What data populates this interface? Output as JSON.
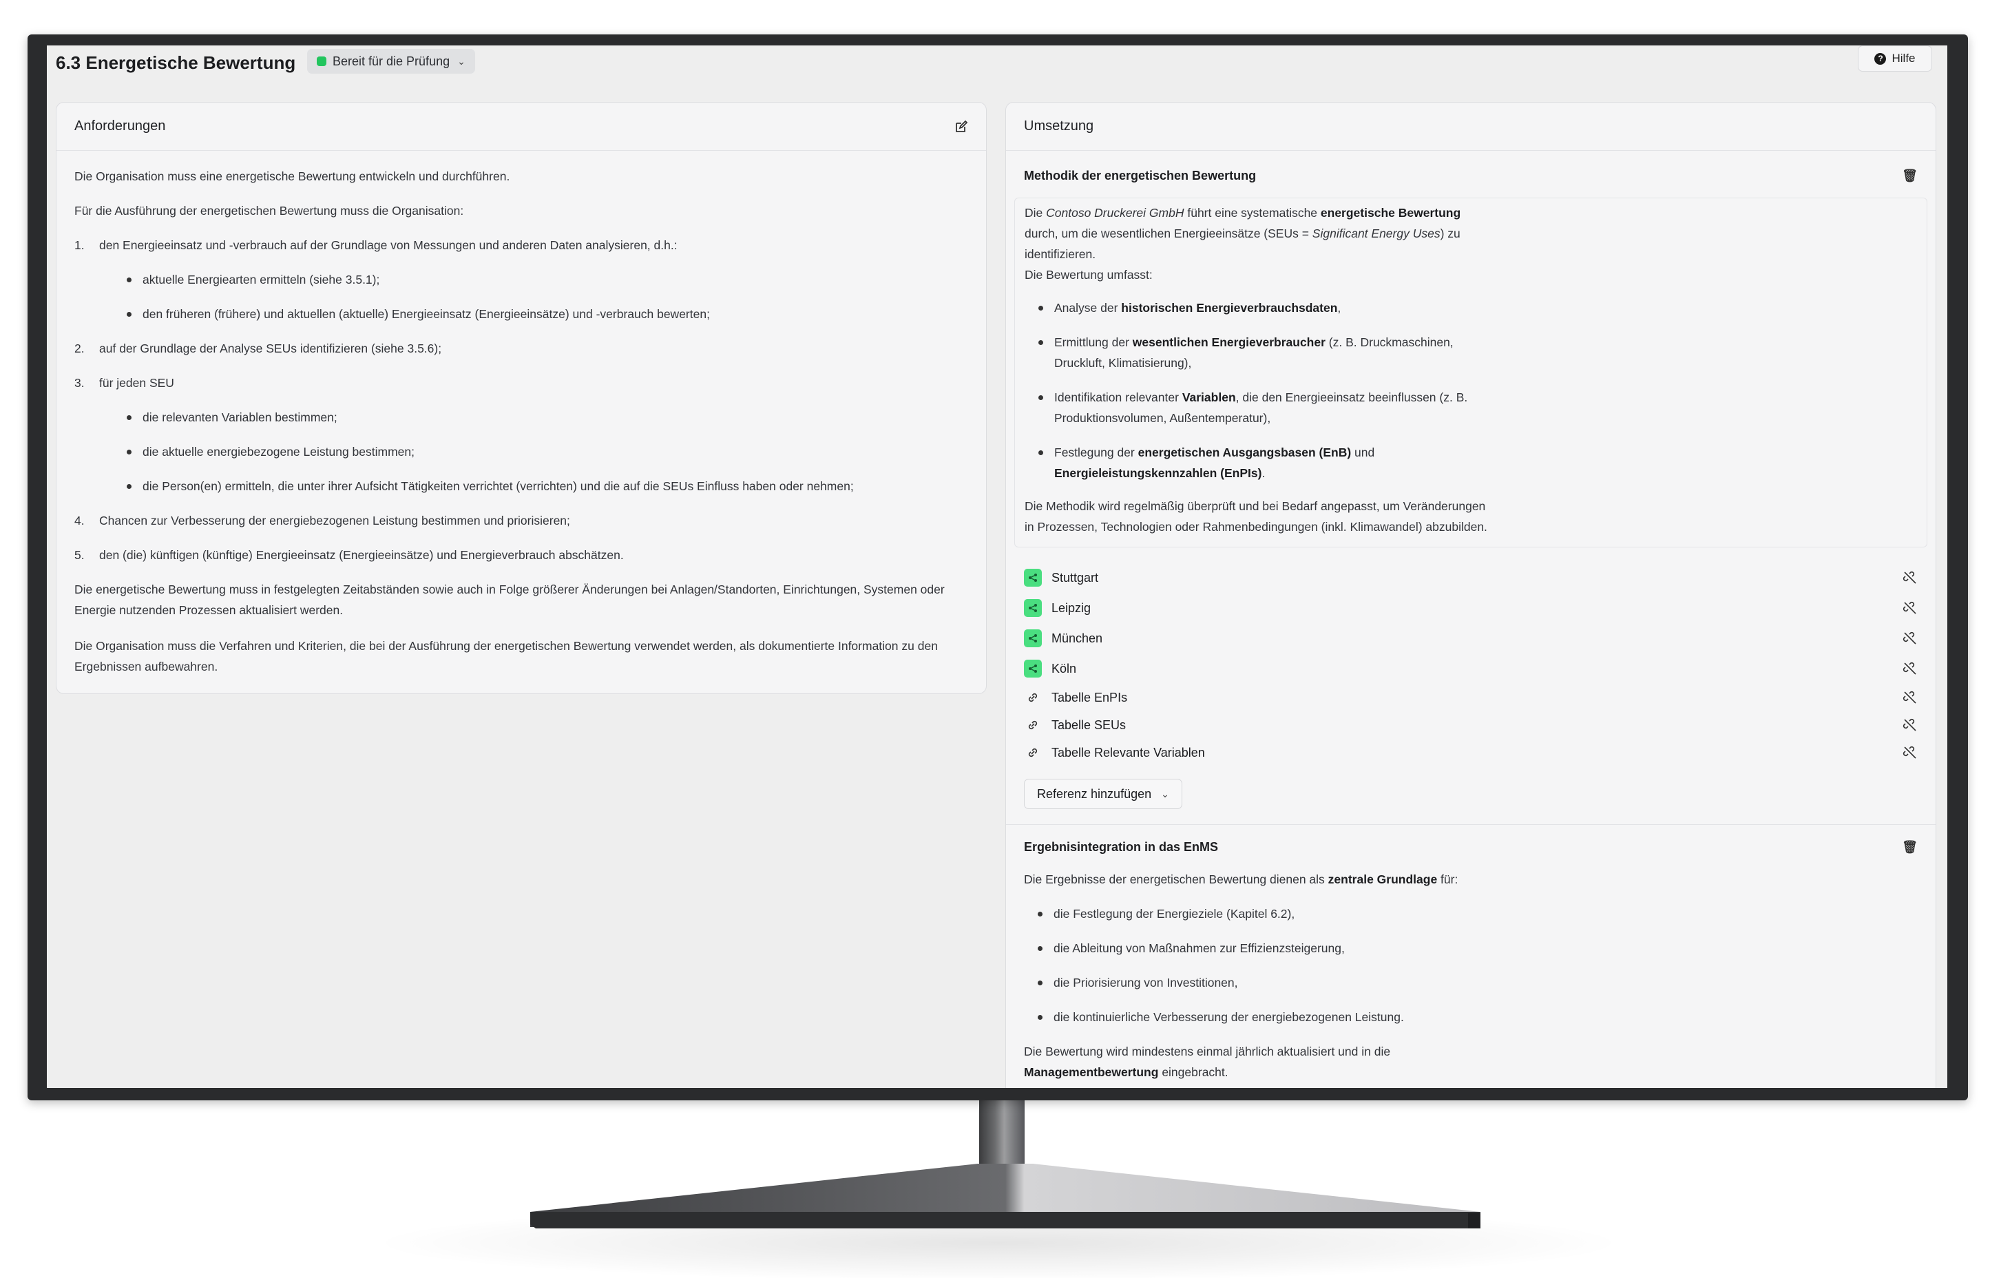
{
  "header": {
    "title": "6.3 Energetische Bewertung",
    "status_label": "Bereit für die Prüfung",
    "help_label": "Hilfe"
  },
  "requirements": {
    "heading": "Anforderungen",
    "intro": "Die Organisation muss eine energetische Bewertung entwickeln und durchführen.",
    "lead": "Für die Ausführung der energetischen Bewertung muss die Organisation:",
    "items": [
      {
        "num": "1.",
        "text": "den Energieeinsatz und -verbrauch auf der Grundlage von Messungen und anderen Daten analysieren, d.h.:",
        "sub": [
          "aktuelle Energiearten ermitteln (siehe 3.5.1);",
          "den früheren (frühere) und aktuellen (aktuelle) Energieeinsatz (Energieeinsätze) und -verbrauch bewerten;"
        ]
      },
      {
        "num": "2.",
        "text": "auf der Grundlage der Analyse SEUs identifizieren (siehe 3.5.6);",
        "sub": []
      },
      {
        "num": "3.",
        "text": "für jeden SEU",
        "sub": [
          "die relevanten Variablen bestimmen;",
          "die aktuelle energiebezogene Leistung bestimmen;",
          "die Person(en) ermitteln, die unter ihrer Aufsicht Tätigkeiten verrichtet (verrichten) und die auf die SEUs Einfluss haben oder nehmen;"
        ]
      },
      {
        "num": "4.",
        "text": "Chancen zur Verbesserung der energiebezogenen Leistung bestimmen und priorisieren;",
        "sub": []
      },
      {
        "num": "5.",
        "text": "den (die) künftigen (künftige) Energieeinsatz (Energieeinsätze) und Energieverbrauch abschätzen.",
        "sub": []
      }
    ],
    "para_update": "Die energetische Bewertung muss in festgelegten Zeitabständen sowie auch in Folge größerer Änderungen bei Anlagen/Standorten, Einrichtungen, Systemen oder Energie nutzenden Prozessen aktualisiert werden.",
    "para_docs": "Die Organisation muss die Verfahren und Kriterien, die bei der Ausführung der energetischen Bewertung verwendet werden, als dokumentierte Information zu den Ergebnissen aufbewahren."
  },
  "implementation": {
    "heading": "Umsetzung",
    "method": {
      "title": "Methodik der energetischen Bewertung",
      "p1_a": "Die ",
      "p1_company": "Contoso Druckerei GmbH",
      "p1_b": " führt eine systematische ",
      "p1_bold": "energetische Bewertung",
      "p1_c": "durch, um die wesentlichen Energieeinsätze (SEUs = ",
      "p1_italic": "Significant Energy Uses",
      "p1_d": ") zu identifizieren.",
      "p1_e": "Die Bewertung umfasst:",
      "b1_a": "Analyse der ",
      "b1_bold": "historischen Energieverbrauchsdaten",
      "b1_c": ",",
      "b2_a": "Ermittlung der ",
      "b2_bold": "wesentlichen Energieverbraucher",
      "b2_c": " (z. B. Druckmaschinen,",
      "b2_d": "Druckluft, Klimatisierung),",
      "b3_a": "Identifikation relevanter ",
      "b3_bold": "Variablen",
      "b3_c": ", die den Energieeinsatz beeinflussen (z. B.",
      "b3_d": "Produktionsvolumen, Außentemperatur),",
      "b4_a": "Festlegung der ",
      "b4_bold": "energetischen Ausgangsbasen (EnB)",
      "b4_c": " und",
      "b4_bold2": "Energieleistungskennzahlen (EnPIs)",
      "b4_d": ".",
      "p2": "Die Methodik wird regelmäßig überprüft und bei Bedarf angepasst, um Veränderungen",
      "p2b": "in Prozessen, Technologien oder Rahmenbedingungen (inkl. Klimawandel) abzubilden."
    },
    "references": [
      {
        "label": "Stuttgart",
        "kind": "site"
      },
      {
        "label": "Leipzig",
        "kind": "site"
      },
      {
        "label": "München",
        "kind": "site"
      },
      {
        "label": "Köln",
        "kind": "site"
      },
      {
        "label": "Tabelle EnPIs",
        "kind": "link"
      },
      {
        "label": "Tabelle SEUs",
        "kind": "link"
      },
      {
        "label": "Tabelle Relevante Variablen",
        "kind": "link"
      }
    ],
    "add_reference_label": "Referenz hinzufügen",
    "integration": {
      "title": "Ergebnisintegration in das EnMS",
      "p1_a": "Die Ergebnisse der energetischen Bewertung dienen als ",
      "p1_bold": "zentrale Grundlage",
      "p1_c": " für:",
      "bullets": [
        "die Festlegung der Energieziele (Kapitel 6.2),",
        "die Ableitung von Maßnahmen zur Effizienzsteigerung,",
        "die Priorisierung von Investitionen,",
        "die kontinuierliche Verbesserung der energiebezogenen Leistung."
      ],
      "p2": "Die Bewertung wird mindestens einmal jährlich aktualisiert und in die",
      "p2_bold": "Managementbewertung",
      "p2_c": " eingebracht."
    }
  },
  "colors": {
    "status_dot": "#22c55e",
    "site_icon_bg": "#4ade80",
    "screen_bg": "#eeeeee",
    "card_bg": "#f5f5f6",
    "bezel": "#2a2b2d"
  },
  "icons": {
    "edit": "edit-icon",
    "trash": "trash-icon",
    "site": "share-nodes-icon",
    "link": "link-icon",
    "unlink": "unlink-icon",
    "help": "question-circle-icon"
  }
}
